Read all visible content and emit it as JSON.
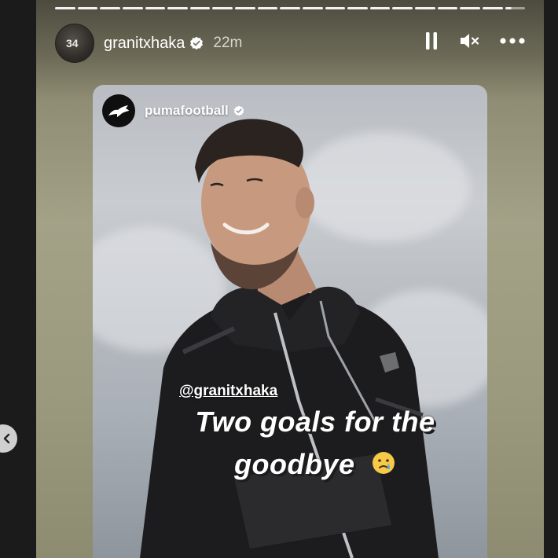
{
  "story": {
    "username": "granitxhaka",
    "time": "22m",
    "avatar_number": "34"
  },
  "controls": {
    "pause_icon": "pause-icon",
    "mute_icon": "muted-speaker-icon",
    "more_icon": "more-options-icon"
  },
  "post": {
    "account": "pumafootball",
    "mention": "@granitxhaka",
    "caption_line1": "Two goals for the",
    "caption_line2": "goodbye"
  },
  "nav": {
    "prev_icon": "chevron-left-icon"
  },
  "colors": {
    "verified": "#ffffff",
    "story_bg": "#a3a186"
  }
}
